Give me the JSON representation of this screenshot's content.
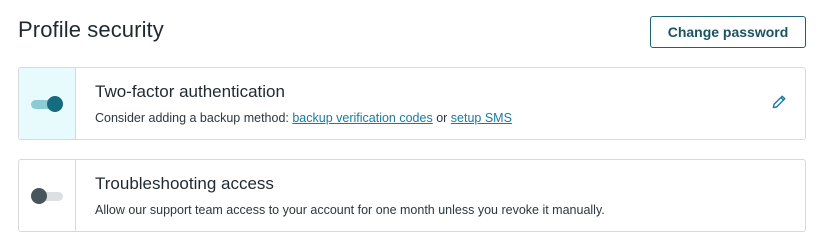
{
  "page": {
    "title": "Profile security",
    "change_password_label": "Change password"
  },
  "two_factor": {
    "title": "Two-factor authentication",
    "enabled": true,
    "desc_prefix": "Consider adding a backup method: ",
    "link_backup": "backup verification codes",
    "desc_join": " or ",
    "link_sms": "setup SMS",
    "edit_icon": "pencil-icon"
  },
  "troubleshooting": {
    "title": "Troubleshooting access",
    "enabled": false,
    "description": "Allow our support team access to your account for one month unless you revoke it manually."
  },
  "colors": {
    "accent": "#176b7e",
    "link": "#1a7aa3",
    "enabled_cell_bg": "#e7fbfd",
    "border": "#d6dadd"
  }
}
